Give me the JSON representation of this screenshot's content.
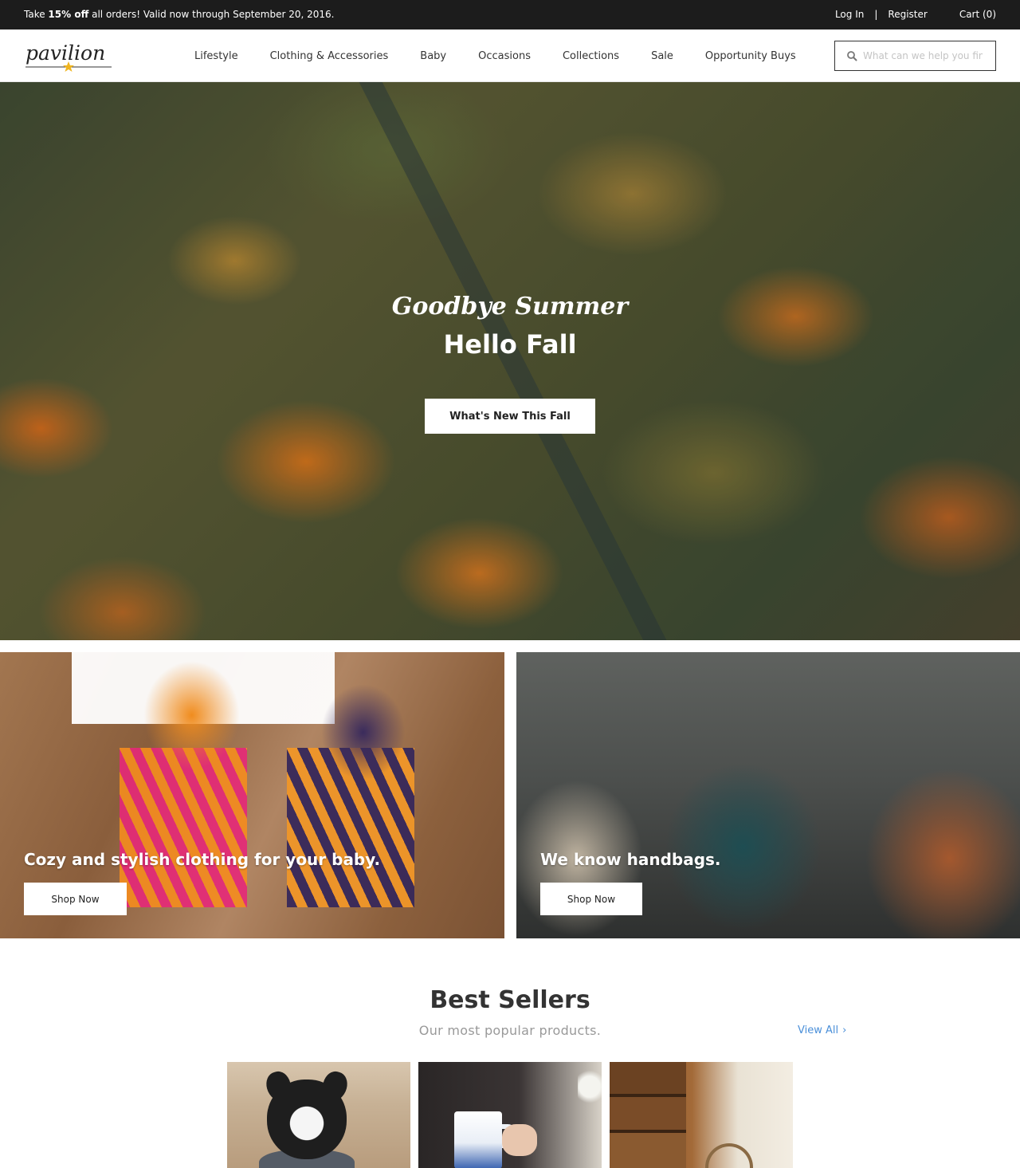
{
  "announcement": {
    "promo_prefix": "Take ",
    "promo_bold": "15% off",
    "promo_suffix": " all orders! Valid now through September 20, 2016.",
    "login": "Log In",
    "separator": "|",
    "register": "Register",
    "cart": "Cart (0)"
  },
  "header": {
    "logo_text": "pavilion",
    "nav": [
      "Lifestyle",
      "Clothing & Accessories",
      "Baby",
      "Occasions",
      "Collections",
      "Sale",
      "Opportunity Buys"
    ],
    "search": {
      "placeholder": "What can we help you fin..."
    }
  },
  "hero": {
    "script_line": "Goodbye Summer",
    "title": "Hello Fall",
    "cta": "What's New This Fall"
  },
  "tiles": [
    {
      "caption": "Cozy and stylish clothing for your baby.",
      "button": "Shop Now"
    },
    {
      "caption": "We know handbags.",
      "button": "Shop Now"
    }
  ],
  "best_sellers": {
    "title": "Best Sellers",
    "subtitle": "Our most popular products.",
    "view_all": "View All",
    "view_all_icon": "chevron-right-icon"
  },
  "colors": {
    "topbar_bg": "#1c1c1c",
    "link_blue": "#4a8fd9",
    "logo_star": "#f0b51f"
  }
}
